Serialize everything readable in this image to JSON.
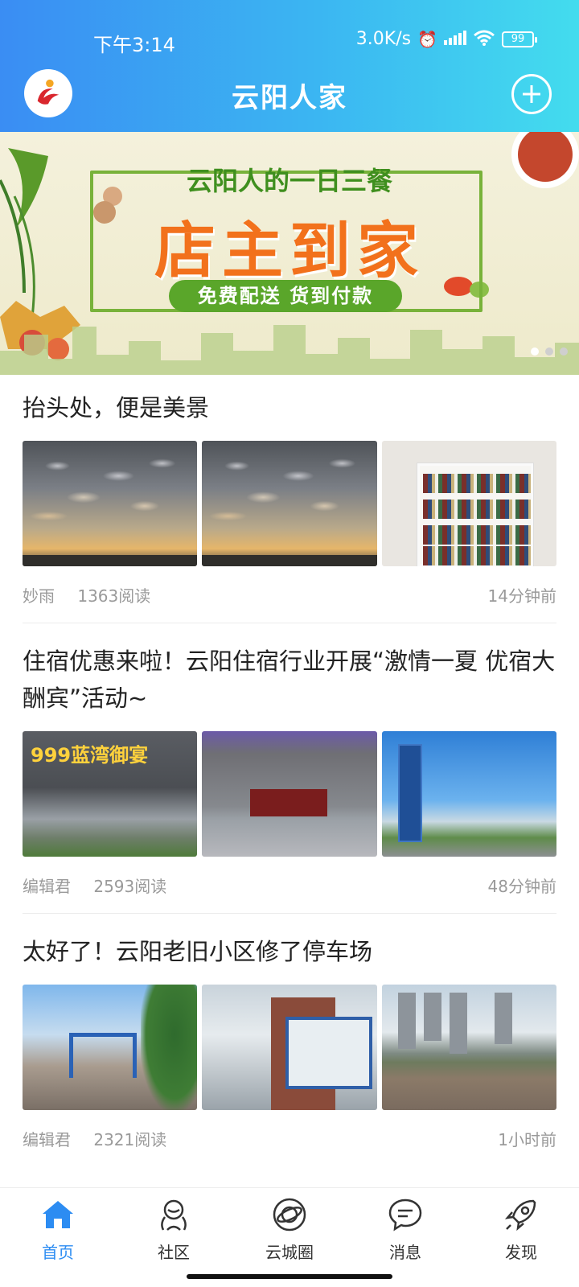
{
  "status_bar": {
    "time": "下午3:14",
    "network_speed": "3.0K/s",
    "alarm_icon": "alarm-icon",
    "signal_icon": "signal-icon",
    "wifi_icon": "wifi-icon",
    "battery": "99"
  },
  "header": {
    "title": "云阳人家",
    "logo_icon": "app-logo-icon",
    "add_icon": "plus-circle-icon"
  },
  "banner": {
    "subtitle": "云阳人的一日三餐",
    "main_text": "店主到家",
    "pill_text": "免费配送  货到付款",
    "slide_count": 3,
    "active_slide": 1
  },
  "articles": [
    {
      "title": "抬头处，便是美景",
      "author": "妙雨",
      "reads": "1363阅读",
      "time": "14分钟前"
    },
    {
      "title": "住宿优惠来啦！云阳住宿行业开展“激情一夏 优宿大酬宾”活动~",
      "author": "编辑君",
      "reads": "2593阅读",
      "time": "48分钟前",
      "image_sign": "999蓝湾御宴"
    },
    {
      "title": "太好了！云阳老旧小区修了停车场",
      "author": "编辑君",
      "reads": "2321阅读",
      "time": "1小时前"
    }
  ],
  "bottom_nav": [
    {
      "label": "首页",
      "icon": "home-icon",
      "active": true
    },
    {
      "label": "社区",
      "icon": "community-icon",
      "active": false
    },
    {
      "label": "云城圈",
      "icon": "planet-icon",
      "active": false
    },
    {
      "label": "消息",
      "icon": "message-icon",
      "active": false
    },
    {
      "label": "发现",
      "icon": "rocket-icon",
      "active": false
    }
  ],
  "colors": {
    "header_start": "#3a8df3",
    "header_end": "#43dcee",
    "accent": "#2c8cf2",
    "banner_orange": "#f2711c",
    "banner_green": "#5aa62a"
  }
}
